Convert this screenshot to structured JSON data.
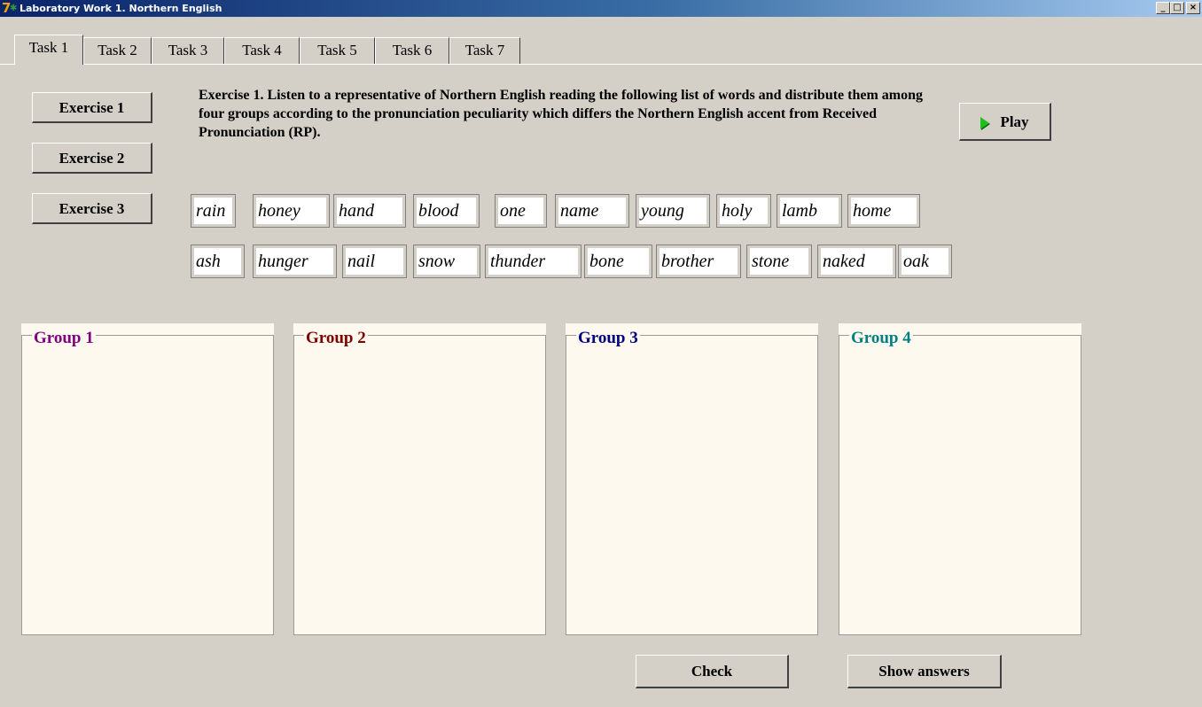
{
  "window": {
    "title": "Laboratory Work 1. Northern English"
  },
  "titlebar_buttons": {
    "minimize": "_",
    "maximize": "□",
    "close": "×"
  },
  "tabs": [
    {
      "label": "Task 1"
    },
    {
      "label": "Task 2"
    },
    {
      "label": "Task 3"
    },
    {
      "label": "Task 4"
    },
    {
      "label": "Task 5"
    },
    {
      "label": "Task 6"
    },
    {
      "label": "Task 7"
    }
  ],
  "exercises": [
    {
      "label": "Exercise 1"
    },
    {
      "label": "Exercise 2"
    },
    {
      "label": "Exercise 3"
    }
  ],
  "instructions": "Exercise 1. Listen to a representative of Northern English reading the following list of words and distribute them among four groups according to the pronunciation peculiarity which differs the Northern English accent from Received Pronunciation (RP).",
  "play": {
    "label": "Play",
    "icon": "play-icon"
  },
  "words_row1": [
    "rain",
    "honey",
    "hand",
    "blood",
    "one",
    "name",
    "young",
    "holy",
    "lamb",
    "home"
  ],
  "words_row2": [
    "ash",
    "hunger",
    "nail",
    "snow",
    "thunder",
    "bone",
    "brother",
    "stone",
    "naked",
    "oak"
  ],
  "groups": [
    {
      "label": "Group 1",
      "color": "#800080"
    },
    {
      "label": "Group 2",
      "color": "#800000"
    },
    {
      "label": "Group 3",
      "color": "#000080"
    },
    {
      "label": "Group 4",
      "color": "#008080"
    }
  ],
  "actions": {
    "check": "Check",
    "show_answers": "Show answers"
  }
}
